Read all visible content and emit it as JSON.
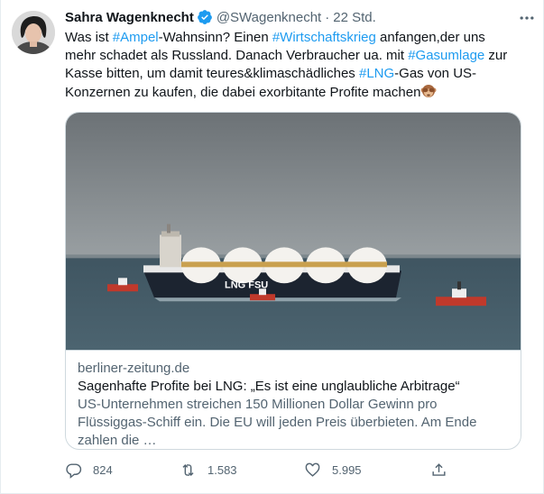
{
  "tweet": {
    "name": "Sahra Wagenknecht",
    "handle": "@SWagenknecht",
    "separator": "·",
    "time": "22 Std.",
    "text_parts": [
      {
        "t": "Was ist ",
        "tag": false
      },
      {
        "t": "#Ampel",
        "tag": true
      },
      {
        "t": "-Wahnsinn? Einen ",
        "tag": false
      },
      {
        "t": "#Wirtschaftskrieg",
        "tag": true
      },
      {
        "t": " anfangen,der uns mehr schadet als Russland. Danach Verbraucher ua. mit ",
        "tag": false
      },
      {
        "t": "#Gasumlage",
        "tag": true
      },
      {
        "t": " zur Kasse bitten, um damit teures&klimaschädliches ",
        "tag": false
      },
      {
        "t": "#LNG",
        "tag": true
      },
      {
        "t": "-Gas von US-Konzernen zu kaufen, die dabei exorbitante Profite machen",
        "tag": false
      }
    ],
    "emoji_icon": "see-no-evil-monkey-icon"
  },
  "card": {
    "image_text": "LNG FSU",
    "domain": "berliner-zeitung.de",
    "title": "Sagenhafte Profite bei LNG: „Es ist eine unglaubliche Arbitrage“",
    "description": "US-Unternehmen streichen 150 Millionen Dollar Gewinn pro Flüssiggas-Schiff ein. Die EU will jeden Preis überbieten. Am Ende zahlen die …"
  },
  "actions": {
    "replies": "824",
    "retweets": "1.583",
    "likes": "5.995"
  },
  "colors": {
    "link": "#1d9bf0",
    "secondary": "#536471",
    "verified": "#1d9bf0"
  }
}
